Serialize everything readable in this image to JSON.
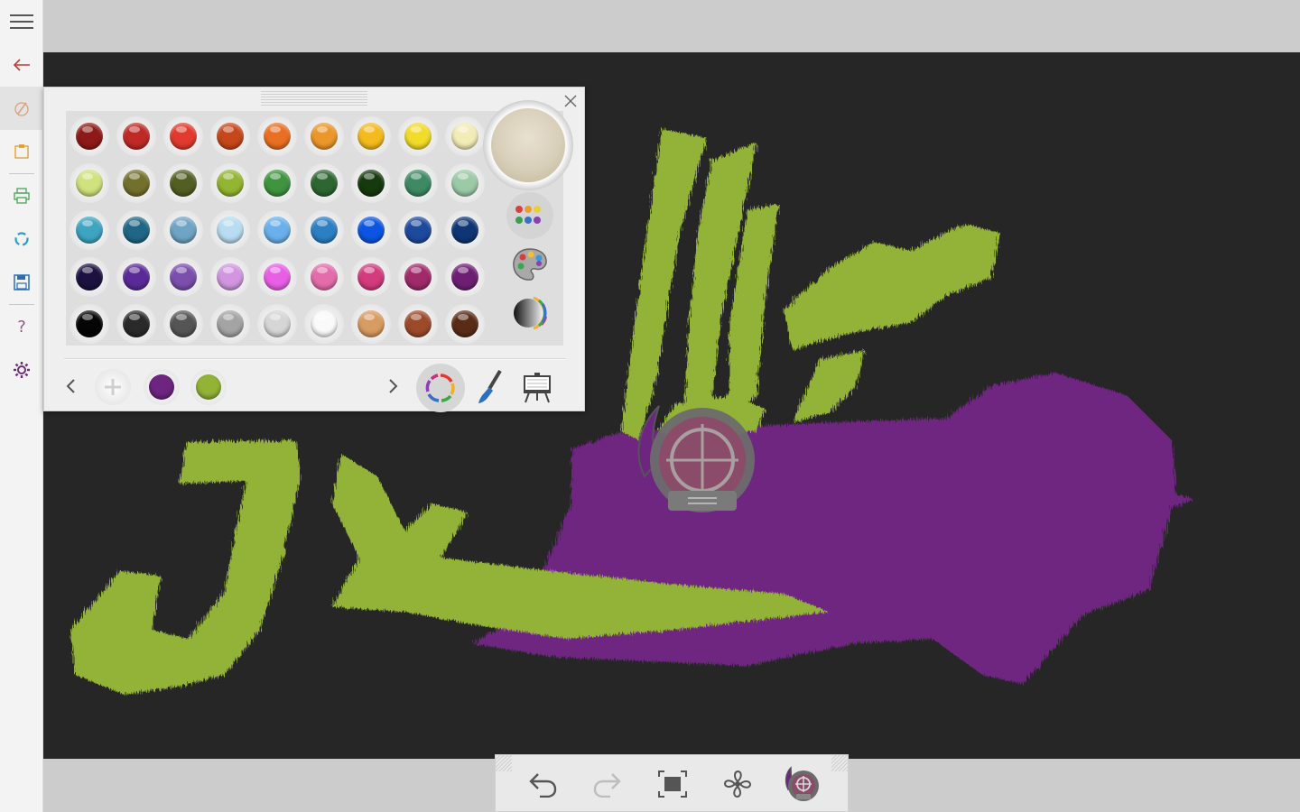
{
  "sidebar": {
    "items": [
      {
        "name": "menu-button",
        "icon": "hamburger-icon"
      },
      {
        "name": "back-button",
        "icon": "arrow-left-icon"
      },
      {
        "name": "brush-mode-button",
        "icon": "brush-icon",
        "active": true
      },
      {
        "name": "paste-button",
        "icon": "clipboard-icon"
      },
      {
        "name": "print-button",
        "icon": "printer-icon"
      },
      {
        "name": "share-button",
        "icon": "share-icon"
      },
      {
        "name": "save-button",
        "icon": "save-icon"
      },
      {
        "name": "help-button",
        "icon": "help-icon",
        "label": "?"
      },
      {
        "name": "settings-button",
        "icon": "gear-icon"
      }
    ]
  },
  "palette": {
    "current_color": "#d8cfb9",
    "swatches": [
      [
        "#8e1a17",
        "#c02a26",
        "#e23a2c",
        "#c6471b",
        "#ea6f22",
        "#ec9729",
        "#f3bb1e",
        "#f2dc2a",
        "#f2ecb6"
      ],
      [
        "#cfe27c",
        "#73702c",
        "#525e22",
        "#94b531",
        "#3f943f",
        "#2d6630",
        "#16390e",
        "#3d8a64",
        "#9ccaa7"
      ],
      [
        "#3da4c2",
        "#1f6786",
        "#6fa4c4",
        "#b8dcf2",
        "#6ab0ec",
        "#2b7fc3",
        "#0b55e2",
        "#1e4a9e",
        "#0e3674"
      ],
      [
        "#1c1140",
        "#5a2a98",
        "#7b4fae",
        "#d296e0",
        "#e85fe6",
        "#e46cab",
        "#d23b7d",
        "#a12a6a",
        "#6e1f74"
      ],
      [
        "#050505",
        "#2a2a2a",
        "#555555",
        "#a4a4a4",
        "#d6d6d6",
        "#fafafa",
        "#d89b62",
        "#9d4a2a",
        "#5a2c18"
      ]
    ],
    "recent_colors": [
      "#6e2580",
      "#93b337"
    ],
    "tool_icons": [
      "color-sets-icon",
      "palette-icon",
      "gradient-icon",
      "color-wheel-icon",
      "brush-icon",
      "easel-icon"
    ]
  },
  "toolbar": {
    "buttons": [
      {
        "name": "undo-button",
        "icon": "undo-icon",
        "enabled": true
      },
      {
        "name": "redo-button",
        "icon": "redo-icon",
        "enabled": false
      },
      {
        "name": "fit-screen-button",
        "icon": "fit-screen-icon",
        "enabled": true
      },
      {
        "name": "dry-button",
        "icon": "fan-icon",
        "enabled": true
      },
      {
        "name": "color-picker-button",
        "icon": "eyedropper-reticle-icon",
        "enabled": true
      }
    ]
  },
  "strokes": {
    "green": "#93b337",
    "purple": "#6e2580",
    "canvas_bg": "#262626"
  }
}
